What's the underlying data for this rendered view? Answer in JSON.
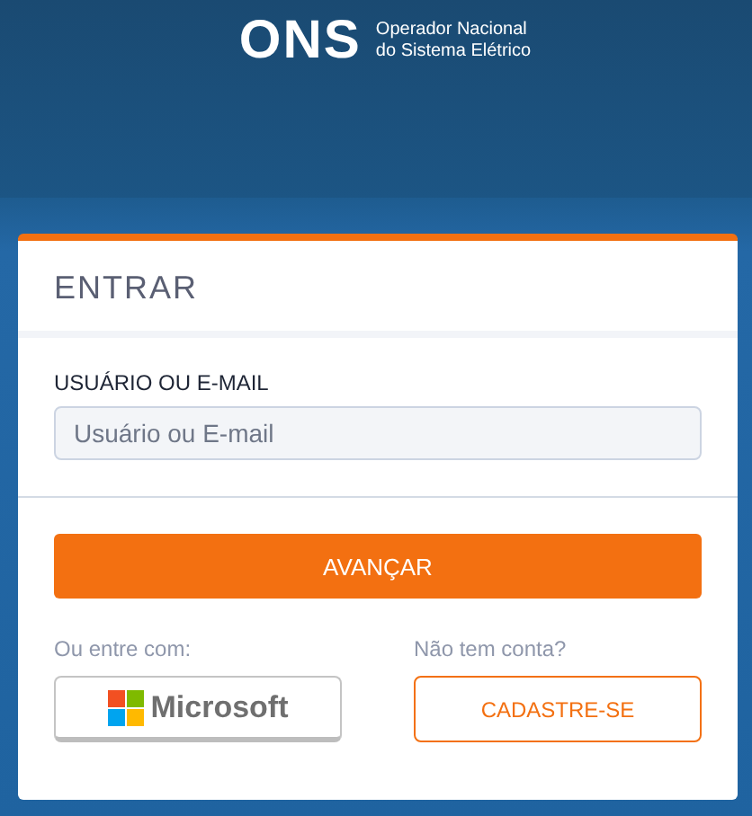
{
  "header": {
    "logo": "ONS",
    "tagline_1": "Operador Nacional",
    "tagline_2": "do Sistema Elétrico"
  },
  "card": {
    "title": "ENTRAR",
    "field": {
      "label": "USUÁRIO OU E-MAIL",
      "placeholder": "Usuário ou E-mail"
    },
    "submit": "AVANÇAR",
    "alt_login": {
      "caption": "Ou entre com:",
      "button": "Microsoft"
    },
    "signup": {
      "caption": "Não tem conta?",
      "button": "CADASTRE-SE"
    }
  }
}
